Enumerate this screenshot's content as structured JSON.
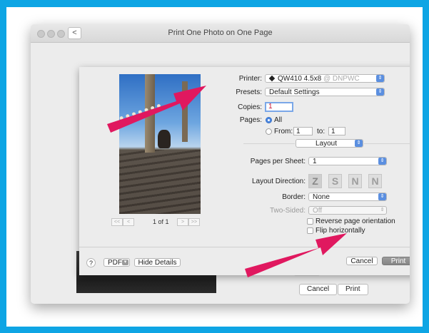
{
  "window": {
    "title": "Print One Photo on One Page",
    "back_glyph": "<"
  },
  "preview": {
    "page_label": "1 of 1",
    "first_glyph": "<<",
    "prev_glyph": "<",
    "next_glyph": ">",
    "last_glyph": ">>"
  },
  "form": {
    "printer_label": "Printer:",
    "printer_name": "QW410 4.5x8",
    "printer_location": "@ DNPWC",
    "presets_label": "Presets:",
    "presets_value": "Default Settings",
    "copies_label": "Copies:",
    "copies_value": "1",
    "pages_label": "Pages:",
    "pages_all": "All",
    "pages_from_label": "From:",
    "pages_from_value": "1",
    "pages_to_label": "to:",
    "pages_to_value": "1",
    "section_value": "Layout",
    "pages_per_sheet_label": "Pages per Sheet:",
    "pages_per_sheet_value": "1",
    "layout_direction_label": "Layout Direction:",
    "layout_direction_glyphs": [
      "Z",
      "S",
      "N",
      "N"
    ],
    "border_label": "Border:",
    "border_value": "None",
    "two_sided_label": "Two-Sided:",
    "two_sided_value": "Off",
    "reverse_label": "Reverse page orientation",
    "flip_label": "Flip horizontally"
  },
  "bottom": {
    "help": "?",
    "pdf": "PDF",
    "hide_details": "Hide Details",
    "cancel": "Cancel",
    "print": "Print"
  },
  "background_dialog": {
    "cancel": "Cancel",
    "print": "Print"
  },
  "colors": {
    "frame": "#0ea5e4",
    "annotation_arrow": "#e0185f",
    "accent": "#4a86e0"
  },
  "icons": [
    "chevron-left-icon",
    "printer-icon",
    "up-down-arrows-icon",
    "question-icon",
    "chevron-down-icon"
  ]
}
